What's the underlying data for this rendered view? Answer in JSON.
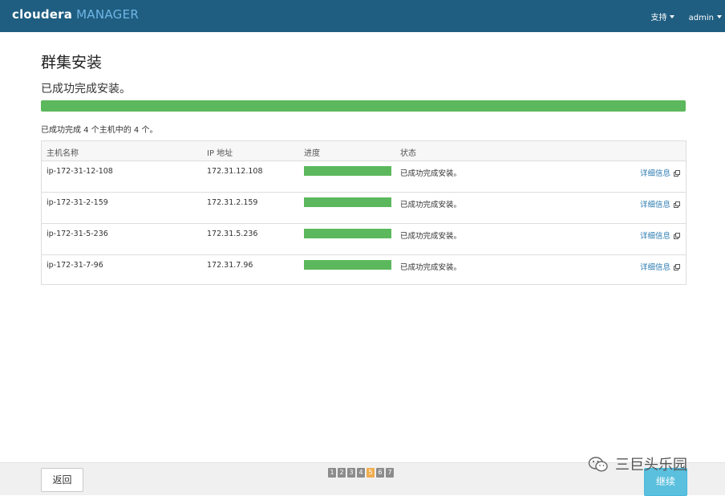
{
  "brand": {
    "name": "cloudera",
    "product": "MANAGER"
  },
  "nav": {
    "support": "支持",
    "user": "admin"
  },
  "page": {
    "title": "群集安装",
    "subtitle": "已成功完成安装。",
    "overall_progress": 1.0,
    "summary": "已成功完成 4 个主机中的 4 个。"
  },
  "table": {
    "columns": [
      "主机名称",
      "IP 地址",
      "进度",
      "状态"
    ],
    "detail_label": "详细信息",
    "rows": [
      {
        "host": "ip-172-31-12-108",
        "ip": "172.31.12.108",
        "progress": 1.0,
        "status": "已成功完成安装。"
      },
      {
        "host": "ip-172-31-2-159",
        "ip": "172.31.2.159",
        "progress": 1.0,
        "status": "已成功完成安装。"
      },
      {
        "host": "ip-172-31-5-236",
        "ip": "172.31.5.236",
        "progress": 1.0,
        "status": "已成功完成安装。"
      },
      {
        "host": "ip-172-31-7-96",
        "ip": "172.31.7.96",
        "progress": 1.0,
        "status": "已成功完成安装。"
      }
    ]
  },
  "footer": {
    "back": "返回",
    "next": "继续",
    "steps": [
      "1",
      "2",
      "3",
      "4",
      "5",
      "6",
      "7"
    ],
    "active_step": "5"
  },
  "watermark": {
    "text": "三巨头乐园",
    "icon": "wechat-icon"
  },
  "colors": {
    "header": "#1f5e81",
    "progress": "#5cb85c",
    "active_step": "#f0ad4e",
    "next_button": "#5bc0de"
  }
}
